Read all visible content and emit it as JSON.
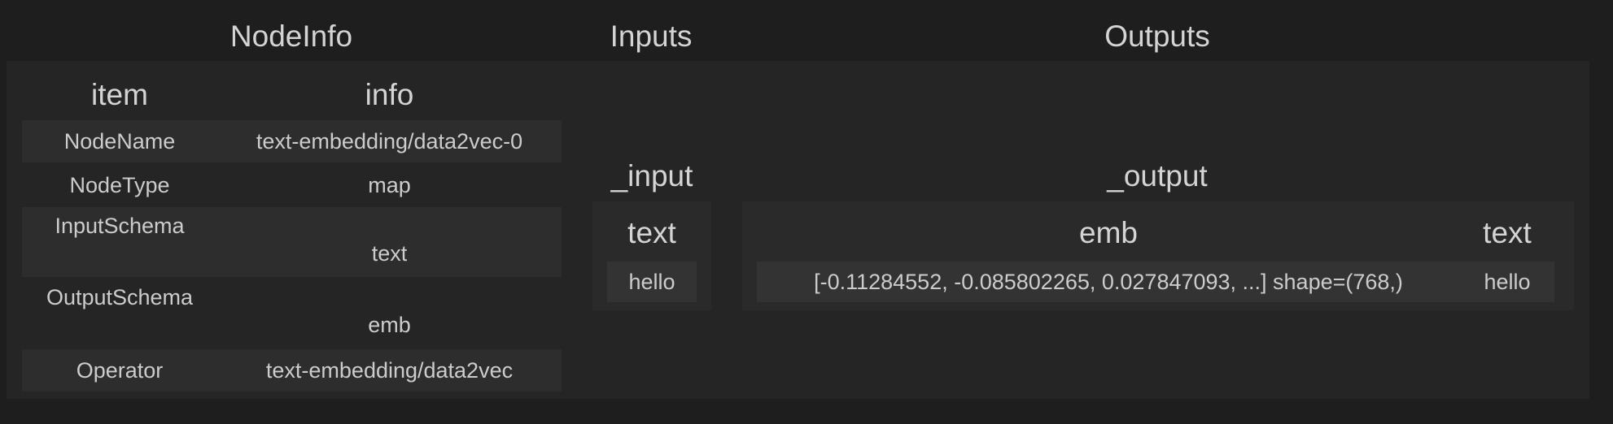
{
  "titles": {
    "nodeinfo": "NodeInfo",
    "inputs": "Inputs",
    "outputs": "Outputs"
  },
  "nodeinfo": {
    "headers": {
      "item": "item",
      "info": "info"
    },
    "rows": [
      {
        "item": "NodeName",
        "info": "text-embedding/data2vec-0"
      },
      {
        "item": "NodeType",
        "info": "map"
      },
      {
        "item": "InputSchema",
        "info": "text"
      },
      {
        "item": "OutputSchema",
        "info": "emb"
      },
      {
        "item": "Operator",
        "info": "text-embedding/data2vec"
      }
    ]
  },
  "inputs": {
    "name": "_input",
    "columns": [
      "text"
    ],
    "values": [
      "hello"
    ]
  },
  "outputs": {
    "name": "_output",
    "columns": [
      "emb",
      "text"
    ],
    "values": [
      "[-0.11284552, -0.085802265, 0.027847093, ...] shape=(768,)",
      "hello"
    ]
  }
}
